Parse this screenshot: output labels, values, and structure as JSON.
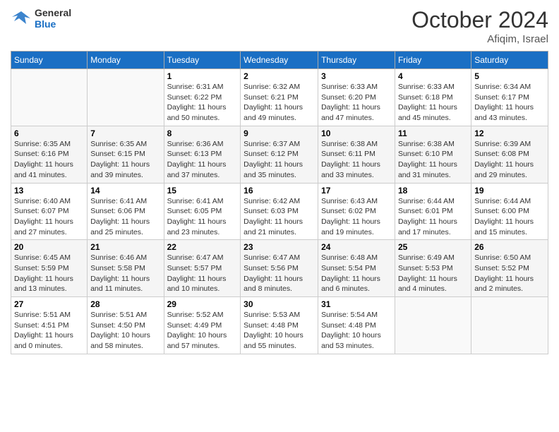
{
  "header": {
    "logo_line1": "General",
    "logo_line2": "Blue",
    "month": "October 2024",
    "location": "Afiqim, Israel"
  },
  "weekdays": [
    "Sunday",
    "Monday",
    "Tuesday",
    "Wednesday",
    "Thursday",
    "Friday",
    "Saturday"
  ],
  "weeks": [
    [
      {
        "day": "",
        "info": ""
      },
      {
        "day": "",
        "info": ""
      },
      {
        "day": "1",
        "info": "Sunrise: 6:31 AM\nSunset: 6:22 PM\nDaylight: 11 hours and 50 minutes."
      },
      {
        "day": "2",
        "info": "Sunrise: 6:32 AM\nSunset: 6:21 PM\nDaylight: 11 hours and 49 minutes."
      },
      {
        "day": "3",
        "info": "Sunrise: 6:33 AM\nSunset: 6:20 PM\nDaylight: 11 hours and 47 minutes."
      },
      {
        "day": "4",
        "info": "Sunrise: 6:33 AM\nSunset: 6:18 PM\nDaylight: 11 hours and 45 minutes."
      },
      {
        "day": "5",
        "info": "Sunrise: 6:34 AM\nSunset: 6:17 PM\nDaylight: 11 hours and 43 minutes."
      }
    ],
    [
      {
        "day": "6",
        "info": "Sunrise: 6:35 AM\nSunset: 6:16 PM\nDaylight: 11 hours and 41 minutes."
      },
      {
        "day": "7",
        "info": "Sunrise: 6:35 AM\nSunset: 6:15 PM\nDaylight: 11 hours and 39 minutes."
      },
      {
        "day": "8",
        "info": "Sunrise: 6:36 AM\nSunset: 6:13 PM\nDaylight: 11 hours and 37 minutes."
      },
      {
        "day": "9",
        "info": "Sunrise: 6:37 AM\nSunset: 6:12 PM\nDaylight: 11 hours and 35 minutes."
      },
      {
        "day": "10",
        "info": "Sunrise: 6:38 AM\nSunset: 6:11 PM\nDaylight: 11 hours and 33 minutes."
      },
      {
        "day": "11",
        "info": "Sunrise: 6:38 AM\nSunset: 6:10 PM\nDaylight: 11 hours and 31 minutes."
      },
      {
        "day": "12",
        "info": "Sunrise: 6:39 AM\nSunset: 6:08 PM\nDaylight: 11 hours and 29 minutes."
      }
    ],
    [
      {
        "day": "13",
        "info": "Sunrise: 6:40 AM\nSunset: 6:07 PM\nDaylight: 11 hours and 27 minutes."
      },
      {
        "day": "14",
        "info": "Sunrise: 6:41 AM\nSunset: 6:06 PM\nDaylight: 11 hours and 25 minutes."
      },
      {
        "day": "15",
        "info": "Sunrise: 6:41 AM\nSunset: 6:05 PM\nDaylight: 11 hours and 23 minutes."
      },
      {
        "day": "16",
        "info": "Sunrise: 6:42 AM\nSunset: 6:03 PM\nDaylight: 11 hours and 21 minutes."
      },
      {
        "day": "17",
        "info": "Sunrise: 6:43 AM\nSunset: 6:02 PM\nDaylight: 11 hours and 19 minutes."
      },
      {
        "day": "18",
        "info": "Sunrise: 6:44 AM\nSunset: 6:01 PM\nDaylight: 11 hours and 17 minutes."
      },
      {
        "day": "19",
        "info": "Sunrise: 6:44 AM\nSunset: 6:00 PM\nDaylight: 11 hours and 15 minutes."
      }
    ],
    [
      {
        "day": "20",
        "info": "Sunrise: 6:45 AM\nSunset: 5:59 PM\nDaylight: 11 hours and 13 minutes."
      },
      {
        "day": "21",
        "info": "Sunrise: 6:46 AM\nSunset: 5:58 PM\nDaylight: 11 hours and 11 minutes."
      },
      {
        "day": "22",
        "info": "Sunrise: 6:47 AM\nSunset: 5:57 PM\nDaylight: 11 hours and 10 minutes."
      },
      {
        "day": "23",
        "info": "Sunrise: 6:47 AM\nSunset: 5:56 PM\nDaylight: 11 hours and 8 minutes."
      },
      {
        "day": "24",
        "info": "Sunrise: 6:48 AM\nSunset: 5:54 PM\nDaylight: 11 hours and 6 minutes."
      },
      {
        "day": "25",
        "info": "Sunrise: 6:49 AM\nSunset: 5:53 PM\nDaylight: 11 hours and 4 minutes."
      },
      {
        "day": "26",
        "info": "Sunrise: 6:50 AM\nSunset: 5:52 PM\nDaylight: 11 hours and 2 minutes."
      }
    ],
    [
      {
        "day": "27",
        "info": "Sunrise: 5:51 AM\nSunset: 4:51 PM\nDaylight: 11 hours and 0 minutes."
      },
      {
        "day": "28",
        "info": "Sunrise: 5:51 AM\nSunset: 4:50 PM\nDaylight: 10 hours and 58 minutes."
      },
      {
        "day": "29",
        "info": "Sunrise: 5:52 AM\nSunset: 4:49 PM\nDaylight: 10 hours and 57 minutes."
      },
      {
        "day": "30",
        "info": "Sunrise: 5:53 AM\nSunset: 4:48 PM\nDaylight: 10 hours and 55 minutes."
      },
      {
        "day": "31",
        "info": "Sunrise: 5:54 AM\nSunset: 4:48 PM\nDaylight: 10 hours and 53 minutes."
      },
      {
        "day": "",
        "info": ""
      },
      {
        "day": "",
        "info": ""
      }
    ]
  ]
}
